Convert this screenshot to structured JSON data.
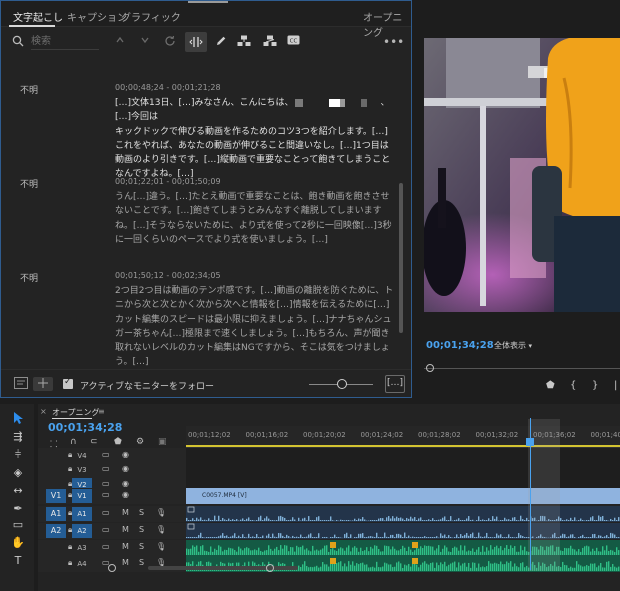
{
  "tabs": [
    {
      "label": "文字起こし",
      "active": true
    },
    {
      "label": "キャプション",
      "active": false
    },
    {
      "label": "グラフィック",
      "active": false
    }
  ],
  "tab_right": "オープニング",
  "search": {
    "placeholder": "検索"
  },
  "segments": [
    {
      "speaker": "不明",
      "timecode": "00;00;48;24 - 00;01;21;28",
      "line1_pre": "[…]文体13日、[…]みなさん、こんにちは、",
      "line1_post": "、[…]今回は",
      "rest": "キックドックで伸びる動画を作るためのコツ3つを紹介します。[…]これをやれば、あなたの動画が伸びること間違いなし。[…]1つ目は動画のより引きです。[…]縦動画で重要なことって飽きてしまうことなんですよね。[…]"
    },
    {
      "speaker": "不明",
      "timecode": "00;01;22;01 - 00;01;50;09",
      "text": "うん[…]違う。[…]たとえ動画で重要なことは、飽き動画を飽きさせないことです。[…]飽きてしまうとみんなすぐ離脱してしまいますね。[…]そうならないために、より式を使って2秒に一回映像[…]3秒に一回くらいのペースでより式を使いましょう。[…]"
    },
    {
      "speaker": "不明",
      "timecode": "00;01;50;12 - 00;02;34;05",
      "text": "2つ目2つ目は動画のテンポ感です。[…]動画の離脱を防ぐために、トニから次と次とかく次から次へと情報を[…]情報を伝えるために[…]カット編集のスピードは最小限に抑えましょう。[…]ナナちゃんシュガー茶ちゃん[…]極限まで速くしましょう。[…]もちろん、声が聞き取れないレベルのカット編集はNGですから、そこは気をつけましょう。[…]"
    }
  ],
  "footer": {
    "follow_label": "アクティブなモニターをフォロー",
    "ellipsis": "[…]"
  },
  "program_monitor": {
    "timecode": "00;01;34;28",
    "fit": "全体表示"
  },
  "timeline": {
    "tab": "オープニング",
    "timecode": "00;01;34;28",
    "ruler": [
      "00;01;12;02",
      "00;01;16;02",
      "00;01;20;02",
      "00;01;24;02",
      "00;01;28;02",
      "00;01;32;02",
      "00;01;36;02",
      "00;01;40;0"
    ],
    "video_clip": "C0057.MP4 [V]",
    "tracks": [
      {
        "src": "",
        "tgt": "V4"
      },
      {
        "src": "",
        "tgt": "V3"
      },
      {
        "src": "",
        "tgt": "V2"
      },
      {
        "src": "V1",
        "tgt": "V1"
      },
      {
        "src": "A1",
        "tgt": "A1"
      },
      {
        "src": "A2",
        "tgt": "A2"
      },
      {
        "src": "",
        "tgt": "A3"
      },
      {
        "src": "",
        "tgt": "A4"
      }
    ],
    "mute": "M",
    "solo": "S"
  },
  "colors": {
    "accent": "#4aa2ee",
    "panel_border": "#2f5c8f",
    "video_clip": "#8fb3df",
    "audio_clip": "#7fb0d8",
    "music_clip": "#2fbf86",
    "in_out": "#d4c431"
  }
}
